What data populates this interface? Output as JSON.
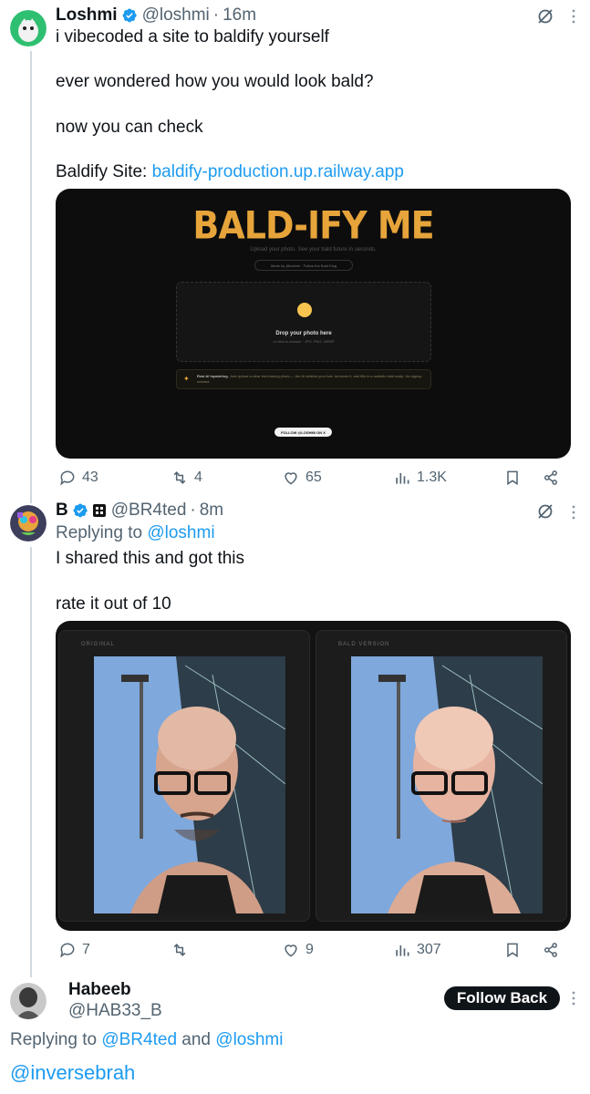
{
  "tweet1": {
    "name": "Loshmi",
    "handle": "@loshmi",
    "time": "16m",
    "lines": [
      "i vibecoded a site to baldify yourself",
      "ever wondered how you would look bald?",
      "now you can check"
    ],
    "site_label": "Baldify Site:",
    "site_link": "baldify-production.up.railway.app",
    "preview": {
      "title": "BALD-IFY ME",
      "subtitle": "Upload your photo. See your bald future in seconds.",
      "made_by": "Made by @loshmi · Follow the Bald King",
      "drop_title": "Drop your photo here",
      "drop_sub": "or click to browse · JPG, PNG, WEBP",
      "info_bold": "Real AI Inpainting.",
      "info_text": "Just upload a clear front-facing photo — the AI detects your hair, removes it, and fills in a realistic bald scalp. No signup needed.",
      "follow_label": "FOLLOW @LOSHMI ON X"
    },
    "stats": {
      "replies": "43",
      "reposts": "4",
      "likes": "65",
      "views": "1.3K"
    }
  },
  "tweet2": {
    "name": "B",
    "handle": "@BR4ted",
    "time": "8m",
    "replying_label": "Replying to",
    "replying_to": "@loshmi",
    "lines": [
      "I shared this and got this",
      "rate it out of 10"
    ],
    "media": {
      "left_label": "ORIGINAL",
      "right_label": "BALD VERSION"
    },
    "stats": {
      "replies": "7",
      "reposts": "",
      "likes": "9",
      "views": "307"
    }
  },
  "tweet3": {
    "name": "Habeeb",
    "handle": "@HAB33_B",
    "follow_label": "Follow Back",
    "replying_label": "Replying to",
    "replying_to_1": "@BR4ted",
    "and_label": "and",
    "replying_to_2": "@loshmi",
    "text": "@inversebrah"
  },
  "colors": {
    "accent": "#1d9bf0",
    "secondary_text": "#536471",
    "bald_title": "#e6a43a"
  }
}
